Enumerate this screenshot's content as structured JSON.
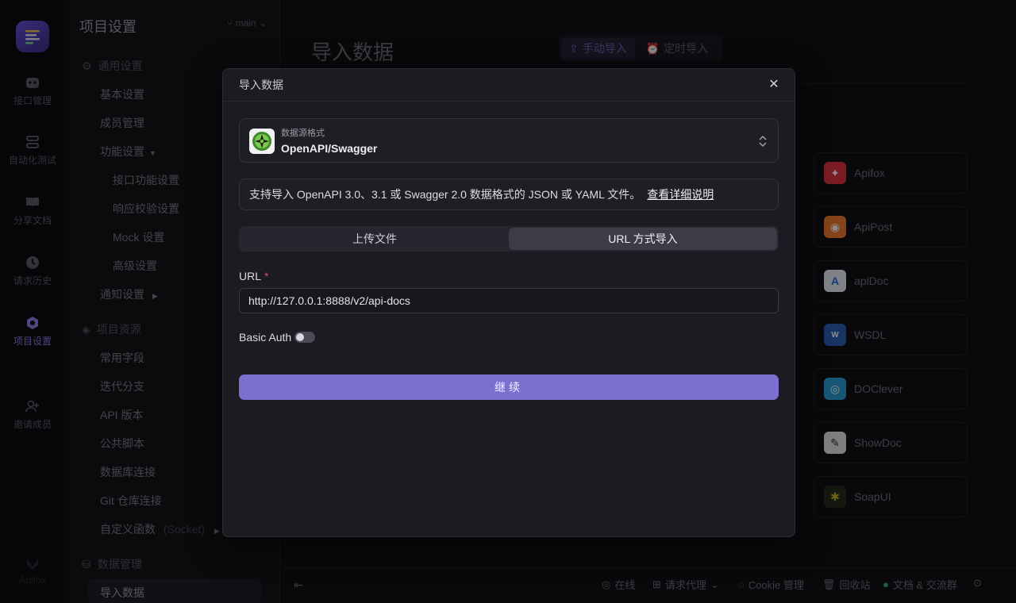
{
  "rail": {
    "items": [
      {
        "label": "接口管理",
        "icon": "api-icon"
      },
      {
        "label": "自动化测试",
        "icon": "test-icon"
      },
      {
        "label": "分享文档",
        "icon": "book-icon"
      },
      {
        "label": "请求历史",
        "icon": "clock-icon"
      },
      {
        "label": "项目设置",
        "icon": "settings-icon"
      },
      {
        "label": "邀请成员",
        "icon": "user-plus-icon"
      }
    ],
    "footer_label": "Apifox"
  },
  "sidebar": {
    "title": "项目设置",
    "branch": "main",
    "general_group": "通用设置",
    "general_items": [
      "基本设置",
      "成员管理",
      "功能设置"
    ],
    "feature_sub_items": [
      "接口功能设置",
      "响应校验设置",
      "Mock 设置",
      "高级设置"
    ],
    "notify_item": "通知设置",
    "resources_group": "项目资源",
    "resource_items": [
      "常用字段",
      "迭代分支",
      "API 版本",
      "公共脚本",
      "数据库连接",
      "Git 仓库连接"
    ],
    "custom_func": "自定义函数",
    "custom_func_note": "(Socket)",
    "data_group": "数据管理",
    "data_items": [
      "导入数据"
    ]
  },
  "main": {
    "title": "导入数据",
    "tab_manual": "手动导入",
    "tab_scheduled": "定时导入",
    "partial_heading": "导入",
    "partial_heading_end": "数据",
    "sources": [
      {
        "name": "Apifox",
        "color": "#e0343f",
        "glyph": "✦"
      },
      {
        "name": "ApiPost",
        "color": "#f07a2e",
        "glyph": "◉"
      },
      {
        "name": "apiDoc",
        "color": "#2f6fd0",
        "glyph": "A"
      },
      {
        "name": "WSDL",
        "color": "#2a5fb3",
        "glyph": "W"
      },
      {
        "name": "DOClever",
        "color": "#2a9fd6",
        "glyph": "◎"
      },
      {
        "name": "ShowDoc",
        "color": "#333333",
        "glyph": "✎"
      },
      {
        "name": "SoapUI",
        "color": "#c8b52a",
        "glyph": "✱"
      }
    ]
  },
  "bottom_bar": {
    "online": "在线",
    "proxy": "请求代理",
    "cookie": "Cookie 管理",
    "trash": "回收站",
    "docs": "文档 & 交流群"
  },
  "modal": {
    "title": "导入数据",
    "format_label": "数据源格式",
    "format_value": "OpenAPI/Swagger",
    "info_text": "支持导入 OpenAPI 3.0、3.1 或 Swagger 2.0 数据格式的 JSON 或 YAML 文件。",
    "info_link": "查看详细说明",
    "tab_upload": "上传文件",
    "tab_url": "URL 方式导入",
    "url_label": "URL",
    "url_required": "*",
    "url_value": "http://127.0.0.1:8888/v2/api-docs",
    "basic_auth": "Basic Auth",
    "basic_auth_on": false,
    "continue": "继续"
  }
}
